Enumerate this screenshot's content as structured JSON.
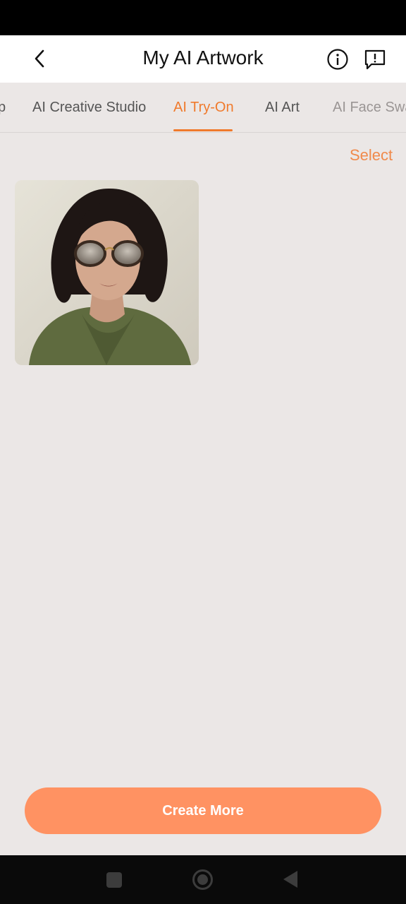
{
  "header": {
    "title": "My AI Artwork",
    "back_icon": "chevron-left-icon",
    "info_icon": "info-circle-icon",
    "feedback_icon": "feedback-alert-icon"
  },
  "tabs": [
    {
      "label": "p",
      "active": false
    },
    {
      "label": "AI Creative Studio",
      "active": false
    },
    {
      "label": "AI Try-On",
      "active": true
    },
    {
      "label": "AI Art",
      "active": false
    },
    {
      "label": "AI Face Swa",
      "active": false
    }
  ],
  "content": {
    "select_label": "Select",
    "artworks": [
      {
        "subject": "Woman with wavy dark bob hair wearing round tortoiseshell sunglasses and an olive green sweater"
      }
    ]
  },
  "footer": {
    "create_more_label": "Create More"
  },
  "colors": {
    "accent": "#f07a2c",
    "button": "#ff9262",
    "background": "#ebe7e6"
  }
}
